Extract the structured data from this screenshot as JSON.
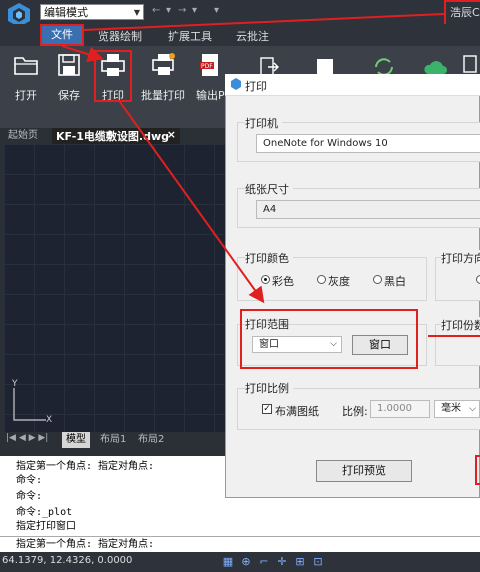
{
  "toolbar": {
    "mode": "编辑模式",
    "quick_access": [
      "←",
      "▾",
      "→",
      "▾",
      "▾"
    ],
    "brand": "浩辰CAD"
  },
  "menu": {
    "file": "文件",
    "items": [
      "览器绘制",
      "扩展工具",
      "云批注"
    ]
  },
  "ribbon": {
    "open": "打开",
    "save": "保存",
    "print": "打印",
    "batch_print": "批量打印",
    "export_pdf": "输出PDF"
  },
  "tabs": {
    "start": "起始页",
    "active": "KF-1电缆敷设图.dwg",
    "close": "×"
  },
  "layout_tabs": [
    "模型",
    "布局1",
    "布局2"
  ],
  "command_lines": [
    "指定第一个角点: 指定对角点:",
    "命令:",
    "命令:",
    "命令:_plot",
    "指定打印窗口"
  ],
  "command_input": "指定第一个角点: 指定对角点:",
  "status": {
    "coords": "64.1379, 12.4326, 0.0000"
  },
  "dialog": {
    "title": "打印",
    "printer_label": "打印机",
    "printer_value": "OneNote for Windows 10",
    "paper_label": "纸张尺寸",
    "paper_value": "A4",
    "color_label": "打印颜色",
    "color_options": [
      "彩色",
      "灰度",
      "黑白"
    ],
    "direction_label": "打印方向",
    "range_label": "打印范围",
    "range_value": "窗口",
    "range_button": "窗口",
    "copies_label": "打印份数",
    "scale_label": "打印比例",
    "fit_label": "布满图纸",
    "ratio_label": "比例:",
    "ratio_value": "1.0000",
    "unit_value": "毫米",
    "preview_button": "打印预览"
  },
  "colors": {
    "accent_red": "#e02020",
    "file_menu_blue": "#3a6fb0"
  }
}
